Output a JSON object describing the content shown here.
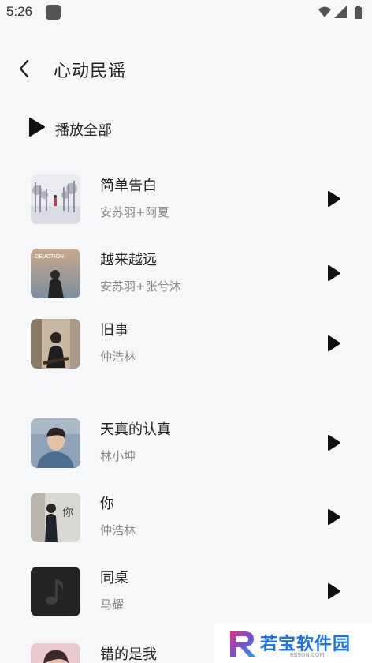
{
  "status_bar": {
    "time": "5:26",
    "icons": [
      "notification-app-icon",
      "wifi-icon",
      "cell-signal-icon",
      "battery-icon"
    ]
  },
  "header": {
    "title": "心动民谣",
    "back_icon": "chevron-left-icon"
  },
  "play_all": {
    "label": "播放全部",
    "icon": "play-icon"
  },
  "songs": [
    {
      "title": "简单告白",
      "artist": "安苏羽+阿夏",
      "cover": "winter-trees-album-cover"
    },
    {
      "title": "越来越远",
      "artist": "安苏羽+张兮沐",
      "cover": "devotion-album-cover",
      "cover_text": "DEVOTION"
    },
    {
      "title": "旧事",
      "artist": "仲浩林",
      "cover": "man-sitting-album-cover"
    },
    {
      "title": "天真的认真",
      "artist": "林小坤",
      "cover": "portrait-album-cover"
    },
    {
      "title": "你",
      "artist": "仲浩林",
      "cover": "man-standing-album-cover",
      "cover_text": "你"
    },
    {
      "title": "同桌",
      "artist": "马耀",
      "cover": "music-note-album-cover"
    },
    {
      "title": "错的是我",
      "artist": "",
      "cover": "pink-portrait-album-cover"
    }
  ],
  "watermark": {
    "text": "若宝软件园",
    "url": "RBSON.COM"
  },
  "colors": {
    "background": "#f6f7f9",
    "title": "#222222",
    "subtitle": "#888888",
    "watermark_blue": "#1a73e8"
  }
}
